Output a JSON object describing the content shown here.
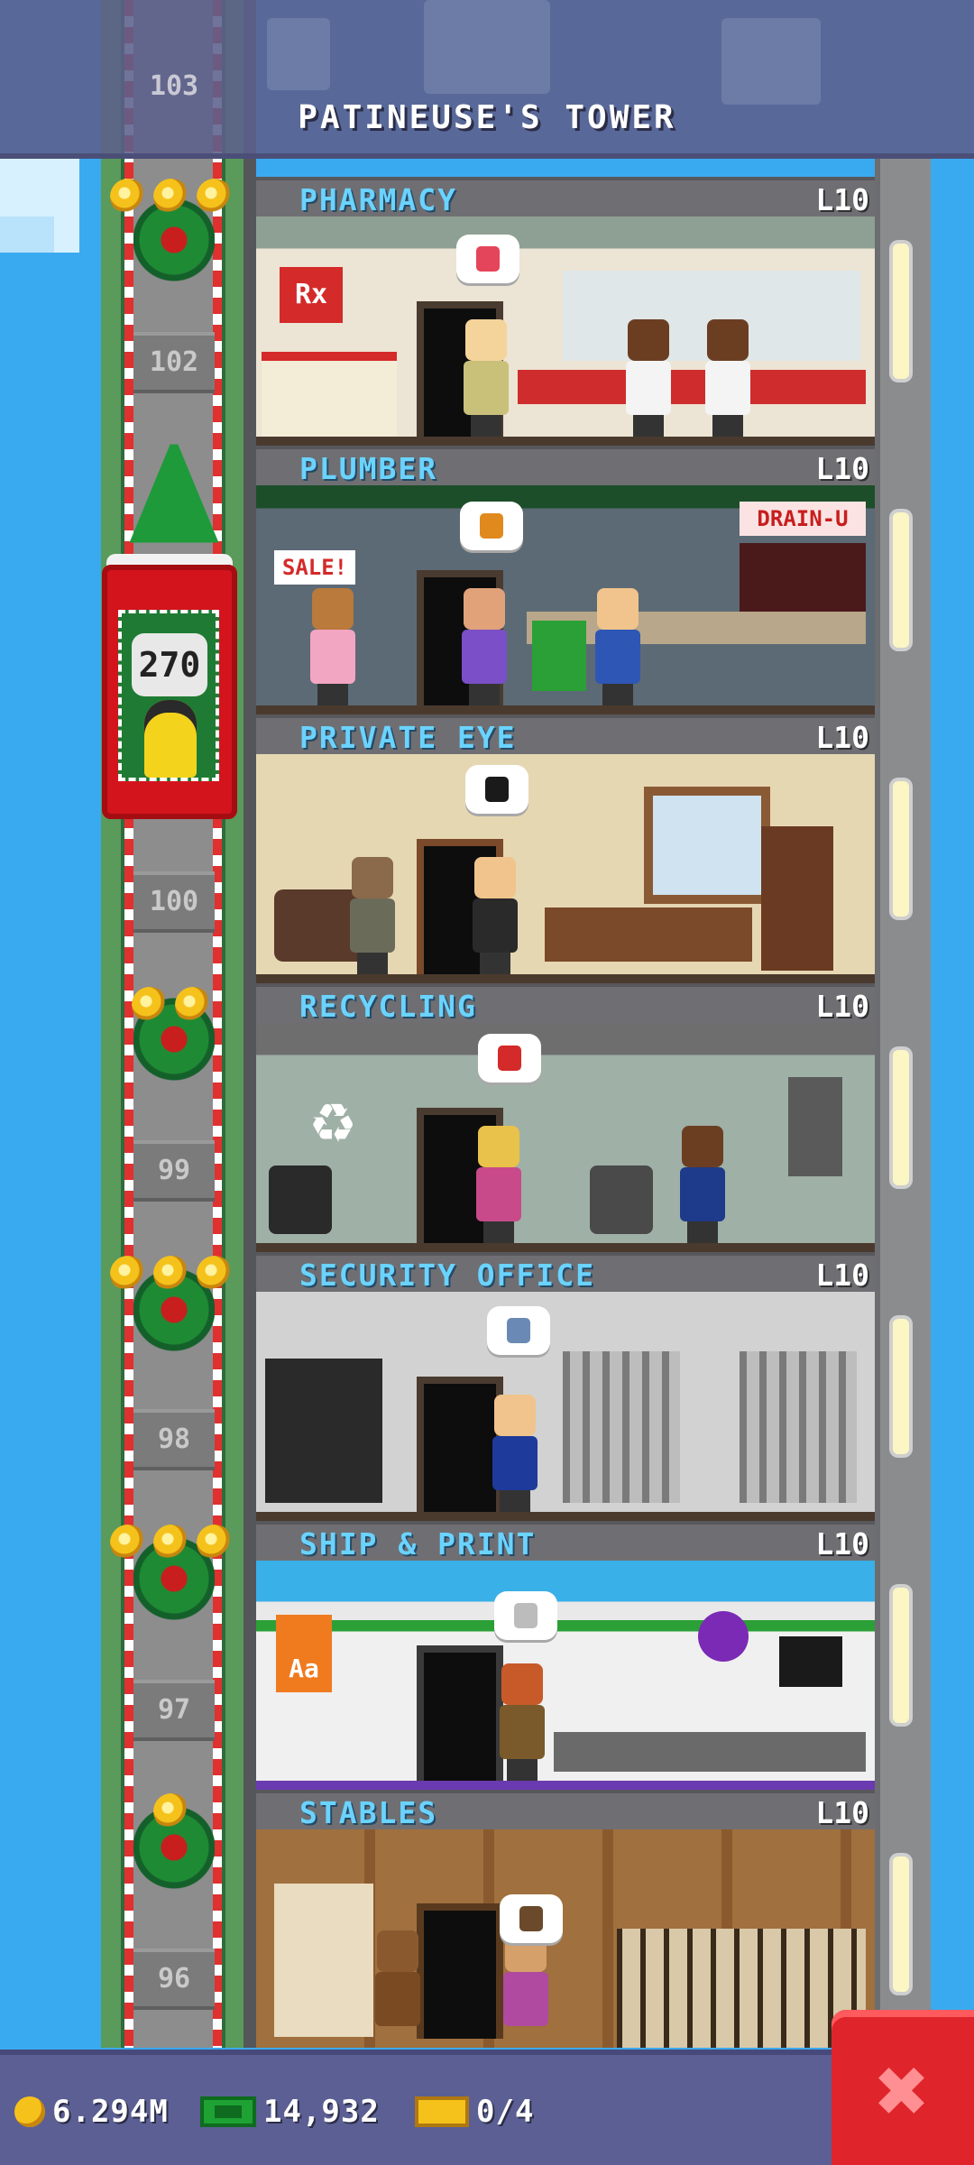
{
  "tower": {
    "title": "PATINEUSE'S TOWER",
    "header_floor_number": "103"
  },
  "elevator": {
    "number": "270"
  },
  "shaft_numbers": [
    "102",
    "100",
    "99",
    "98",
    "97",
    "96"
  ],
  "floors": [
    {
      "name": "PHARMACY",
      "level": "L10"
    },
    {
      "name": "PLUMBER",
      "level": "L10",
      "sign": "DRAIN-U",
      "sale": "SALE!"
    },
    {
      "name": "PRIVATE EYE",
      "level": "L10"
    },
    {
      "name": "RECYCLING",
      "level": "L10"
    },
    {
      "name": "SECURITY OFFICE",
      "level": "L10"
    },
    {
      "name": "SHIP & PRINT",
      "level": "L10"
    },
    {
      "name": "STABLES",
      "level": "L10"
    }
  ],
  "pharmacy_sign": "Rx",
  "shipprint_sign": "Aa",
  "status": {
    "coins": "6.294M",
    "bux": "14,932",
    "tickets": "0/4"
  },
  "close_button": {
    "label": "✖"
  },
  "colors": {
    "sky": "#3aaaf0",
    "elevator": "#d3141c",
    "floor_title": "#6ad3ff",
    "close": "#e0242b"
  }
}
